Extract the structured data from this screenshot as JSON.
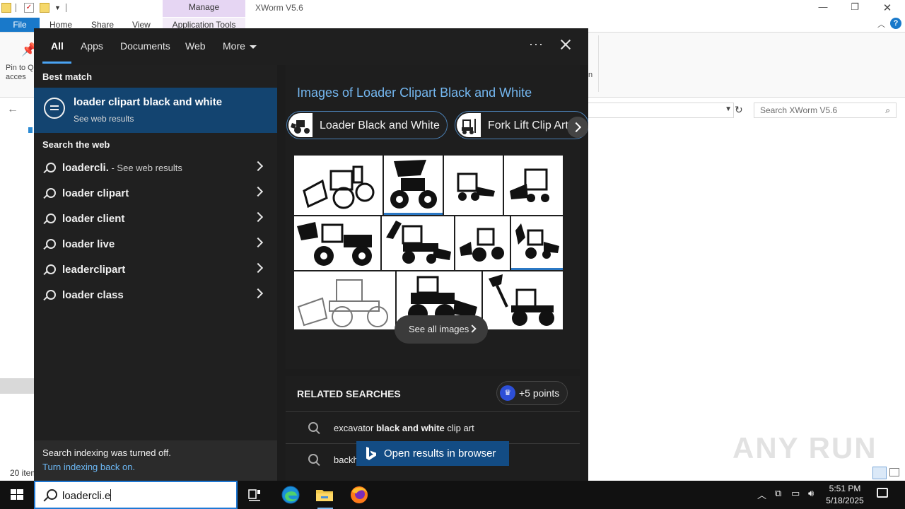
{
  "explorer": {
    "manage_tab": "Manage",
    "window_title": "XWorm V5.6",
    "tabs": {
      "file": "File",
      "home": "Home",
      "share": "Share",
      "view": "View",
      "app_tools": "Application Tools"
    },
    "pin_label": "Pin to Q acces",
    "ribbon_fragment": "n",
    "search_placeholder": "Search XWorm V5.6",
    "items_count": "20 item"
  },
  "search_flyout": {
    "tabs": [
      "All",
      "Apps",
      "Documents",
      "Web",
      "More"
    ],
    "active_tab": "All",
    "best_match_label": "Best match",
    "best_match": {
      "title": "loader clipart black and white",
      "subtitle": "See web results"
    },
    "search_web_label": "Search the web",
    "web_results": [
      {
        "text": "loadercli.",
        "suffix": " - See web results"
      },
      {
        "text": "loader clipart",
        "suffix": ""
      },
      {
        "text": "loader client",
        "suffix": ""
      },
      {
        "text": "loader live",
        "suffix": ""
      },
      {
        "text": "leaderclipart",
        "suffix": ""
      },
      {
        "text": "loader class",
        "suffix": ""
      }
    ],
    "indexing": {
      "message": "Search indexing was turned off.",
      "link": "Turn indexing back on."
    },
    "images_title": "Images of Loader Clipart Black and White",
    "pills": [
      "Loader Black and White",
      "Fork Lift Clip Art"
    ],
    "see_all_images": "See all images",
    "related_title": "RELATED SEARCHES",
    "points": "+5 points",
    "related": [
      {
        "pre": "excavator ",
        "bold": "black and white",
        "post": " clip art"
      },
      {
        "pre": "backh",
        "bold": "",
        "post": ""
      }
    ],
    "open_in_browser": "Open results in browser"
  },
  "taskbar": {
    "search_text": "loadercli.e",
    "clock_time": "5:51 PM",
    "clock_date": "5/18/2025"
  },
  "watermark": "ANY RUN",
  "colors": {
    "accent": "#134470",
    "link": "#74b7f0",
    "taskbar": "#111111",
    "flyout": "#202020"
  }
}
